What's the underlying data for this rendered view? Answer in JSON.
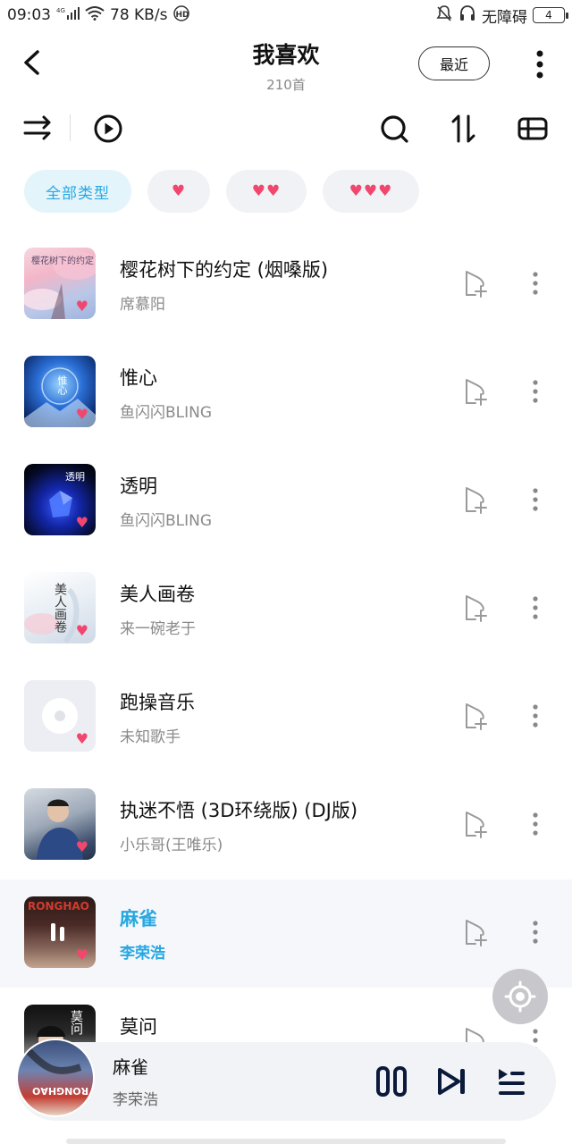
{
  "status_bar": {
    "time": "09:03",
    "network": "4G",
    "speed": "78 KB/s",
    "hd": "HD",
    "accessibility": "无障碍",
    "battery": "4"
  },
  "header": {
    "title": "我喜欢",
    "count": "210首",
    "recent_label": "最近"
  },
  "filters": [
    {
      "label": "全部类型"
    },
    {
      "label": "♥"
    },
    {
      "label": "♥♥"
    },
    {
      "label": "♥♥♥"
    }
  ],
  "songs": [
    {
      "title": "樱花树下的约定 (烟嗓版)",
      "artist": "席慕阳",
      "cover_text": "樱花树下的约定"
    },
    {
      "title": "惟心",
      "artist": "鱼闪闪BLING",
      "cover_text": "惟心"
    },
    {
      "title": "透明",
      "artist": "鱼闪闪BLING",
      "cover_text": "透明"
    },
    {
      "title": "美人画卷",
      "artist": "来一碗老于",
      "cover_text": "美人画卷"
    },
    {
      "title": "跑操音乐",
      "artist": "未知歌手",
      "cover_text": ""
    },
    {
      "title": "执迷不悟 (3D环绕版) (DJ版)",
      "artist": "小乐哥(王唯乐)",
      "cover_text": ""
    },
    {
      "title": "麻雀",
      "artist": "李荣浩",
      "cover_text": "RONGHAO"
    },
    {
      "title": "莫问",
      "artist": "",
      "cover_text": "莫问"
    }
  ],
  "player": {
    "title": "麻雀",
    "artist": "李荣浩",
    "cover_text": "RONGHAO"
  },
  "colors": {
    "accent": "#27a8e0",
    "heart": "#f1476e",
    "chip_bg": "#f1f2f5",
    "chip_active_bg": "#e4f4fb"
  }
}
